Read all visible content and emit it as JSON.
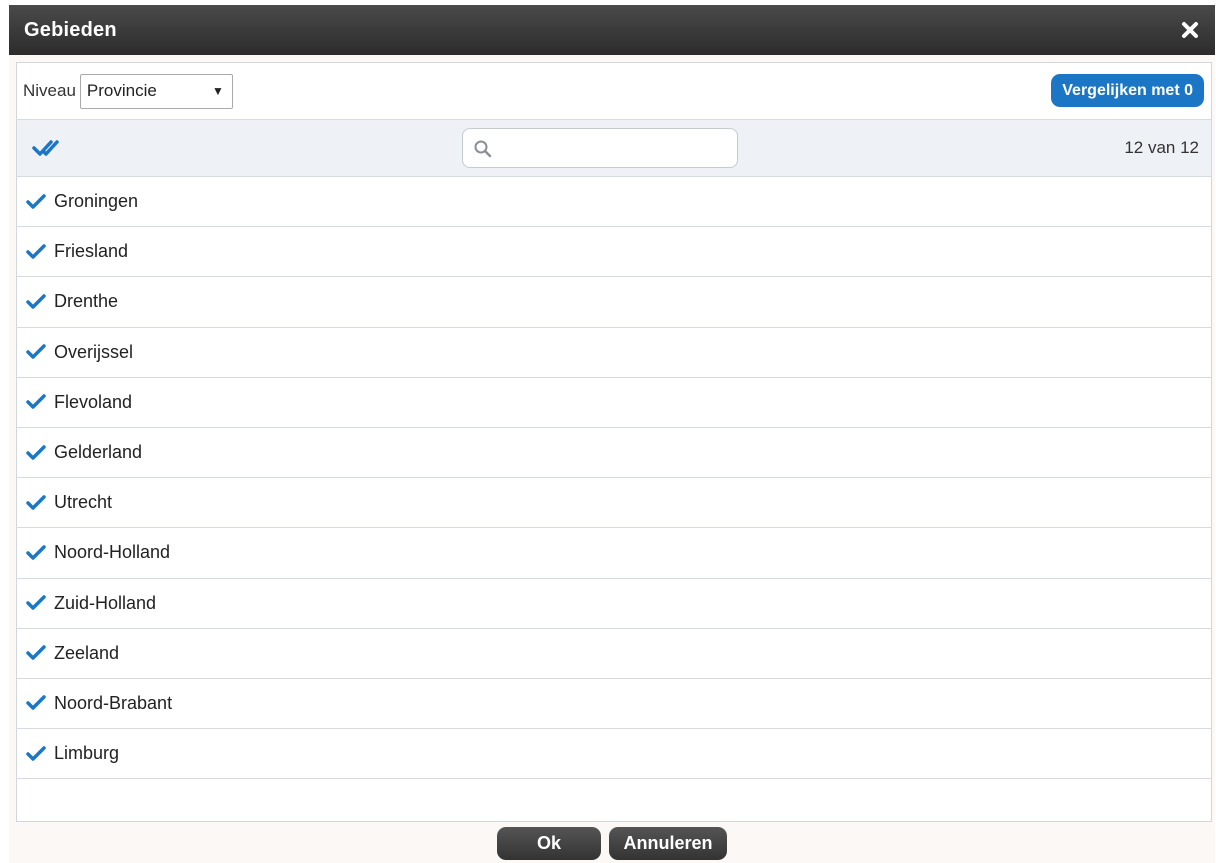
{
  "dialog": {
    "title": "Gebieden",
    "close_icon": "close-icon"
  },
  "toolbar": {
    "niveau_label": "Niveau",
    "niveau_selected": "Provincie",
    "compare_label": "Vergelijken met 0"
  },
  "filter": {
    "check_all_icon": "double-check-icon",
    "search_icon": "search-icon",
    "search_value": "",
    "count_text": "12 van 12"
  },
  "items": [
    {
      "label": "Groningen",
      "checked": true
    },
    {
      "label": "Friesland",
      "checked": true
    },
    {
      "label": "Drenthe",
      "checked": true
    },
    {
      "label": "Overijssel",
      "checked": true
    },
    {
      "label": "Flevoland",
      "checked": true
    },
    {
      "label": "Gelderland",
      "checked": true
    },
    {
      "label": "Utrecht",
      "checked": true
    },
    {
      "label": "Noord-Holland",
      "checked": true
    },
    {
      "label": "Zuid-Holland",
      "checked": true
    },
    {
      "label": "Zeeland",
      "checked": true
    },
    {
      "label": "Noord-Brabant",
      "checked": true
    },
    {
      "label": "Limburg",
      "checked": true
    }
  ],
  "buttons": {
    "ok_label": "Ok",
    "cancel_label": "Annuleren"
  },
  "colors": {
    "accent": "#1b77c6",
    "titlebar": "#333333",
    "row_border": "#d6dae1"
  }
}
